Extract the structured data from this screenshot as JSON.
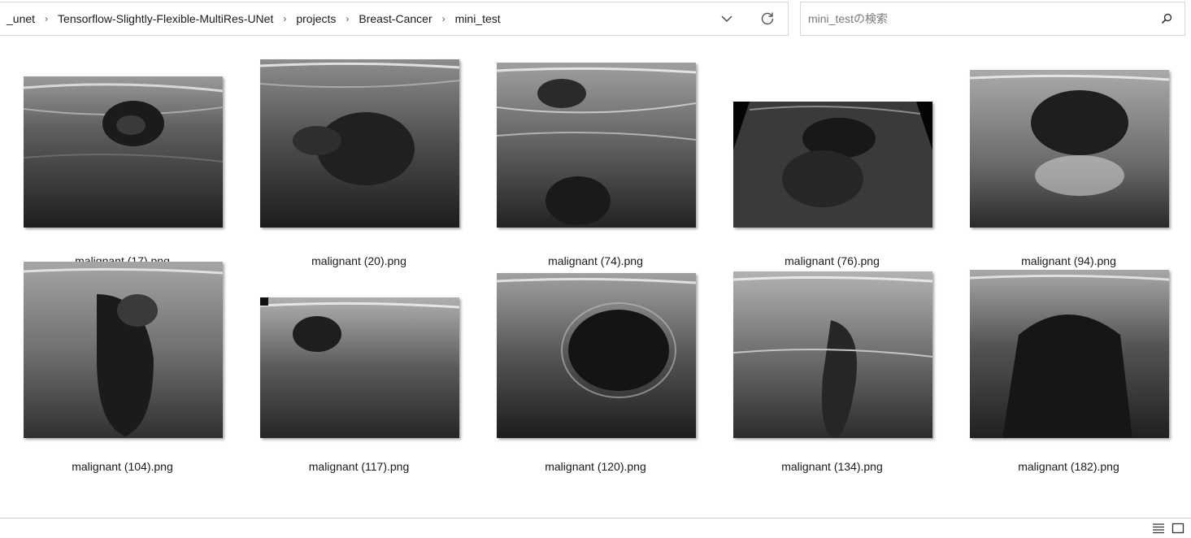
{
  "breadcrumb": {
    "items": [
      "_unet",
      "Tensorflow-Slightly-Flexible-MultiRes-UNet",
      "projects",
      "Breast-Cancer",
      "mini_test"
    ]
  },
  "search": {
    "placeholder": "mini_testの検索"
  },
  "files": [
    {
      "name": "malignant (17).png"
    },
    {
      "name": "malignant (20).png"
    },
    {
      "name": "malignant (74).png"
    },
    {
      "name": "malignant (76).png"
    },
    {
      "name": "malignant (94).png"
    },
    {
      "name": "malignant (104).png"
    },
    {
      "name": "malignant (117).png"
    },
    {
      "name": "malignant (120).png"
    },
    {
      "name": "malignant (134).png"
    },
    {
      "name": "malignant (182).png"
    }
  ],
  "icons": {
    "chevron": "chevron-down-icon",
    "refresh": "refresh-icon",
    "search": "search-icon",
    "details_view": "details-view-icon",
    "large_icons_view": "large-icons-view-icon"
  }
}
